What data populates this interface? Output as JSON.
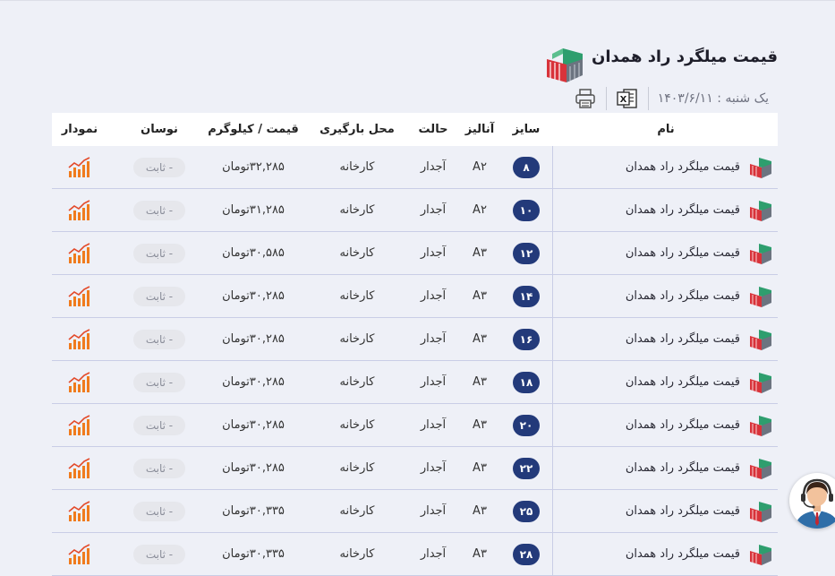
{
  "page": {
    "title": "قیمت میلگرد راد همدان",
    "date": "یک شنبه : ۱۴۰۳/۶/۱۱"
  },
  "toolbar": {
    "excel_icon": "excel-export-icon",
    "print_icon": "print-icon"
  },
  "colors": {
    "size_badge": "#233a7a",
    "chart_orange": "#f07b1d",
    "logo_green": "#2e9e6e",
    "logo_red": "#d8333a"
  },
  "table": {
    "headers": {
      "name": "نام",
      "size": "سایز",
      "analysis": "آنالیز",
      "state": "حالت",
      "place": "محل بارگیری",
      "price": "قیمت / کیلوگرم",
      "fluct": "نوسان",
      "chart": "نمودار"
    },
    "rows": [
      {
        "name": "قیمت میلگرد راد همدان",
        "size": "۸",
        "analysis": "A۲",
        "state": "آجدار",
        "place": "کارخانه",
        "price": "۳۲,۲۸۵تومان",
        "fluct": "ثابت -"
      },
      {
        "name": "قیمت میلگرد راد همدان",
        "size": "۱۰",
        "analysis": "A۲",
        "state": "آجدار",
        "place": "کارخانه",
        "price": "۳۱,۲۸۵تومان",
        "fluct": "ثابت -"
      },
      {
        "name": "قیمت میلگرد راد همدان",
        "size": "۱۲",
        "analysis": "A۳",
        "state": "آجدار",
        "place": "کارخانه",
        "price": "۳۰,۵۸۵تومان",
        "fluct": "ثابت -"
      },
      {
        "name": "قیمت میلگرد راد همدان",
        "size": "۱۴",
        "analysis": "A۳",
        "state": "آجدار",
        "place": "کارخانه",
        "price": "۳۰,۲۸۵تومان",
        "fluct": "ثابت -"
      },
      {
        "name": "قیمت میلگرد راد همدان",
        "size": "۱۶",
        "analysis": "A۳",
        "state": "آجدار",
        "place": "کارخانه",
        "price": "۳۰,۲۸۵تومان",
        "fluct": "ثابت -"
      },
      {
        "name": "قیمت میلگرد راد همدان",
        "size": "۱۸",
        "analysis": "A۳",
        "state": "آجدار",
        "place": "کارخانه",
        "price": "۳۰,۲۸۵تومان",
        "fluct": "ثابت -"
      },
      {
        "name": "قیمت میلگرد راد همدان",
        "size": "۲۰",
        "analysis": "A۳",
        "state": "آجدار",
        "place": "کارخانه",
        "price": "۳۰,۲۸۵تومان",
        "fluct": "ثابت -"
      },
      {
        "name": "قیمت میلگرد راد همدان",
        "size": "۲۲",
        "analysis": "A۳",
        "state": "آجدار",
        "place": "کارخانه",
        "price": "۳۰,۲۸۵تومان",
        "fluct": "ثابت -"
      },
      {
        "name": "قیمت میلگرد راد همدان",
        "size": "۲۵",
        "analysis": "A۳",
        "state": "آجدار",
        "place": "کارخانه",
        "price": "۳۰,۳۳۵تومان",
        "fluct": "ثابت -"
      },
      {
        "name": "قیمت میلگرد راد همدان",
        "size": "۲۸",
        "analysis": "A۳",
        "state": "آجدار",
        "place": "کارخانه",
        "price": "۳۰,۳۳۵تومان",
        "fluct": "ثابت -"
      }
    ]
  }
}
